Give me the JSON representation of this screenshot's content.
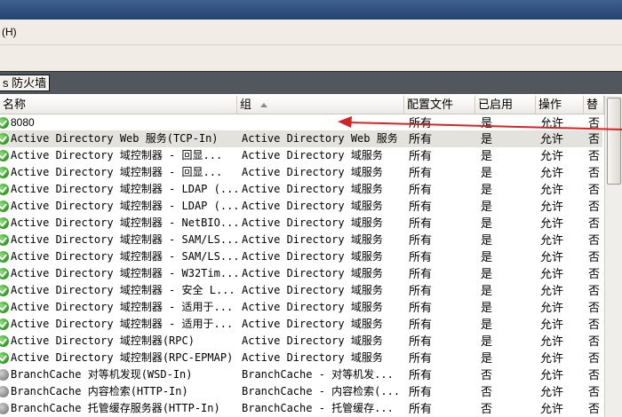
{
  "menu": {
    "help_label": "(H)"
  },
  "panel": {
    "title": "s 防火墙"
  },
  "columns": {
    "name": "名称",
    "group": "组",
    "profile": "配置文件",
    "enabled": "已启用",
    "action": "操作",
    "override": "替"
  },
  "colors": {
    "arrow": "#d42424",
    "title_bar": "#2e4f7e",
    "panel_bar": "#52575e"
  },
  "rules": [
    {
      "icon": "enabled-check-icon",
      "name": "8080",
      "group": "",
      "profile": "所有",
      "enabled": "是",
      "action": "允许",
      "override": "否"
    },
    {
      "icon": "enabled-check-icon",
      "name": "Active Directory Web 服务(TCP-In)",
      "group": "Active Directory Web 服务",
      "profile": "所有",
      "enabled": "是",
      "action": "允许",
      "override": "否"
    },
    {
      "icon": "enabled-check-icon",
      "name": "Active Directory 域控制器 - 回显...",
      "group": "Active Directory 域服务",
      "profile": "所有",
      "enabled": "是",
      "action": "允许",
      "override": "否"
    },
    {
      "icon": "enabled-check-icon",
      "name": "Active Directory 域控制器 - 回显...",
      "group": "Active Directory 域服务",
      "profile": "所有",
      "enabled": "是",
      "action": "允许",
      "override": "否"
    },
    {
      "icon": "enabled-check-icon",
      "name": "Active Directory 域控制器 - LDAP (...",
      "group": "Active Directory 域服务",
      "profile": "所有",
      "enabled": "是",
      "action": "允许",
      "override": "否"
    },
    {
      "icon": "enabled-check-icon",
      "name": "Active Directory 域控制器 - LDAP (...",
      "group": "Active Directory 域服务",
      "profile": "所有",
      "enabled": "是",
      "action": "允许",
      "override": "否"
    },
    {
      "icon": "enabled-check-icon",
      "name": "Active Directory 域控制器 - NetBIO...",
      "group": "Active Directory 域服务",
      "profile": "所有",
      "enabled": "是",
      "action": "允许",
      "override": "否"
    },
    {
      "icon": "enabled-check-icon",
      "name": "Active Directory 域控制器 - SAM/LS...",
      "group": "Active Directory 域服务",
      "profile": "所有",
      "enabled": "是",
      "action": "允许",
      "override": "否"
    },
    {
      "icon": "enabled-check-icon",
      "name": "Active Directory 域控制器 - SAM/LS...",
      "group": "Active Directory 域服务",
      "profile": "所有",
      "enabled": "是",
      "action": "允许",
      "override": "否"
    },
    {
      "icon": "enabled-check-icon",
      "name": "Active Directory 域控制器 - W32Tim...",
      "group": "Active Directory 域服务",
      "profile": "所有",
      "enabled": "是",
      "action": "允许",
      "override": "否"
    },
    {
      "icon": "enabled-check-icon",
      "name": "Active Directory 域控制器 - 安全 L...",
      "group": "Active Directory 域服务",
      "profile": "所有",
      "enabled": "是",
      "action": "允许",
      "override": "否"
    },
    {
      "icon": "enabled-check-icon",
      "name": "Active Directory 域控制器 - 适用于...",
      "group": "Active Directory 域服务",
      "profile": "所有",
      "enabled": "是",
      "action": "允许",
      "override": "否"
    },
    {
      "icon": "enabled-check-icon",
      "name": "Active Directory 域控制器 - 适用于...",
      "group": "Active Directory 域服务",
      "profile": "所有",
      "enabled": "是",
      "action": "允许",
      "override": "否"
    },
    {
      "icon": "enabled-check-icon",
      "name": "Active Directory 域控制器(RPC)",
      "group": "Active Directory 域服务",
      "profile": "所有",
      "enabled": "是",
      "action": "允许",
      "override": "否"
    },
    {
      "icon": "enabled-check-icon",
      "name": "Active Directory 域控制器(RPC-EPMAP)",
      "group": "Active Directory 域服务",
      "profile": "所有",
      "enabled": "是",
      "action": "允许",
      "override": "否"
    },
    {
      "icon": "disabled-rule-icon",
      "name": "BranchCache 对等机发现(WSD-In)",
      "group": "BranchCache - 对等机发...",
      "profile": "所有",
      "enabled": "否",
      "action": "允许",
      "override": "否"
    },
    {
      "icon": "disabled-rule-icon",
      "name": "BranchCache 内容检索(HTTP-In)",
      "group": "BranchCache - 内容检索(...",
      "profile": "所有",
      "enabled": "否",
      "action": "允许",
      "override": "否"
    },
    {
      "icon": "disabled-rule-icon",
      "name": "BranchCache 托管缓存服务器(HTTP-In)",
      "group": "BranchCache - 托管缓存...",
      "profile": "所有",
      "enabled": "否",
      "action": "允许",
      "override": "否"
    }
  ]
}
